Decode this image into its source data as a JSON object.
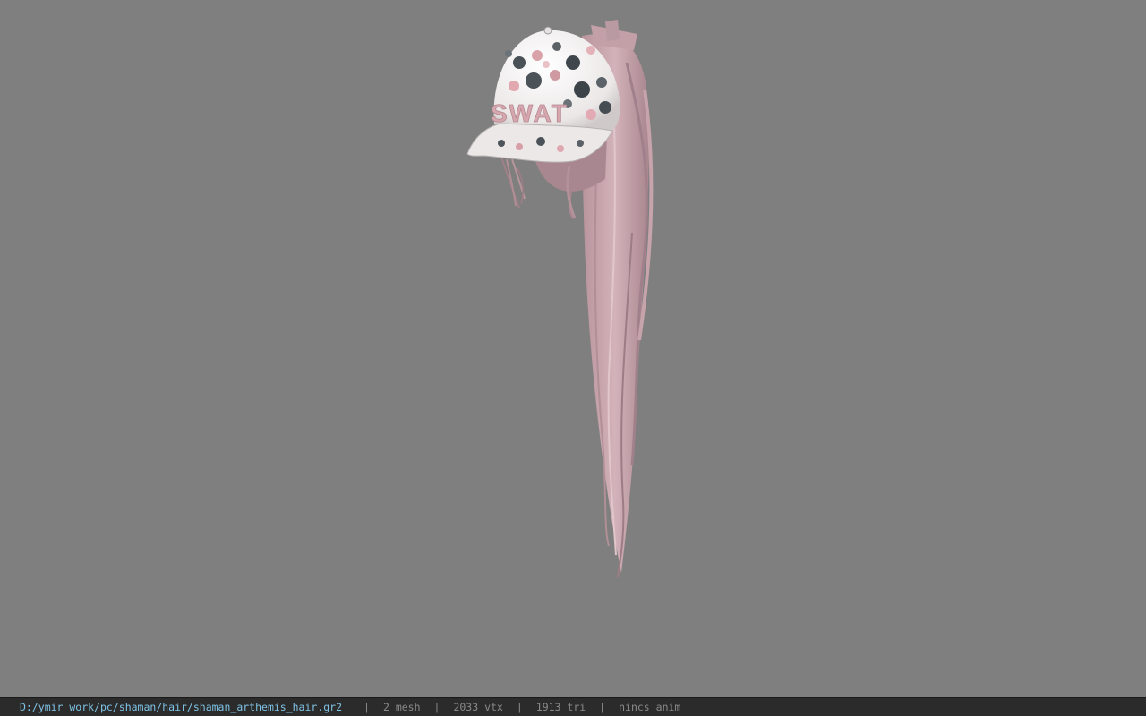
{
  "viewport": {
    "background": "#7f7f7f",
    "model_name": "shaman_arthemis_hair",
    "cap_text": "SWAT",
    "hair_color": "#c9a6ae",
    "cap_color": "#f2efef"
  },
  "statusbar": {
    "path": "D:/ymir work/pc/shaman/hair/shaman_arthemis_hair.gr2",
    "separator": "|",
    "mesh": "2 mesh",
    "vtx": "2033 vtx",
    "tri": "1913 tri",
    "anim": "nincs anim",
    "path_color": "#7fc3e6"
  }
}
